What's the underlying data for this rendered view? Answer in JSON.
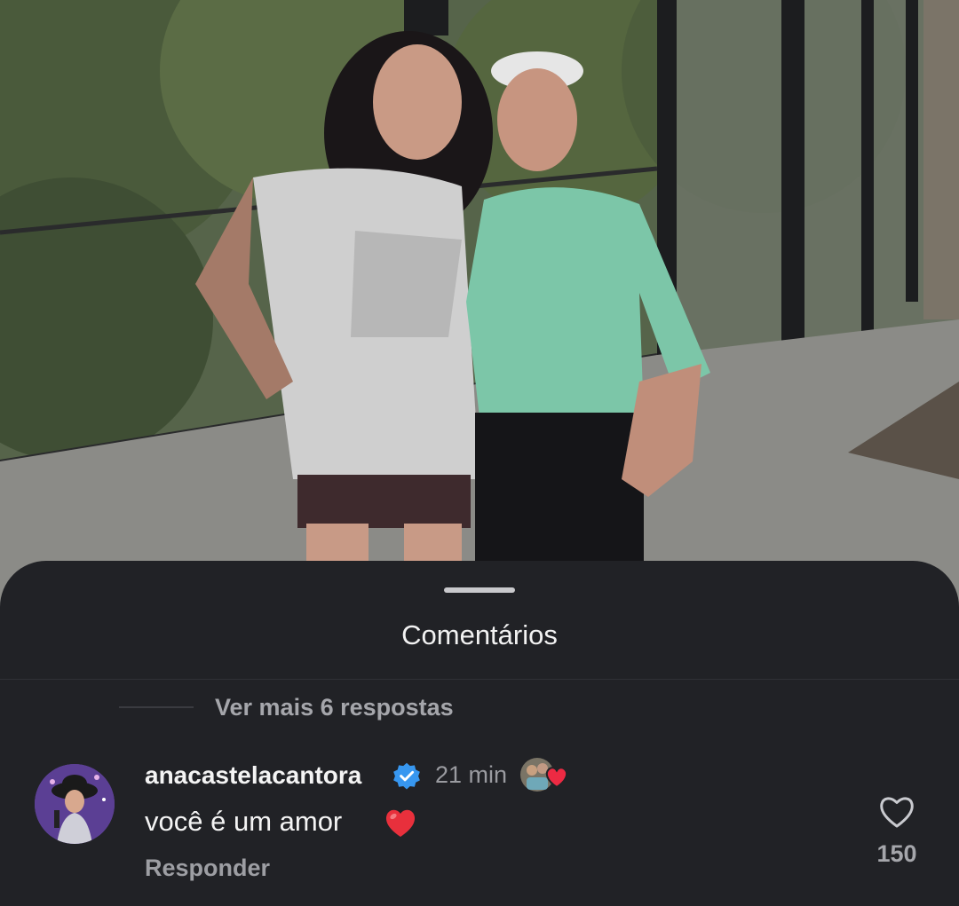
{
  "comments_sheet": {
    "title": "Comentários",
    "more_replies_label": "Ver mais 6 respostas"
  },
  "comment": {
    "username": "anacastelacantora",
    "verified": true,
    "time": "21 min",
    "text": "você é um amor",
    "reply_label": "Responder",
    "like_count": "150"
  },
  "icons": {
    "verified": "verified-badge-icon",
    "heart_emoji": "red-heart-emoji",
    "like": "heart-outline-icon",
    "creator_reaction": "creator-liked-avatar-heart-icon"
  },
  "colors": {
    "sheet_background": "#212226",
    "verified_blue": "#3797f0",
    "heart_red": "#ed2a43"
  }
}
